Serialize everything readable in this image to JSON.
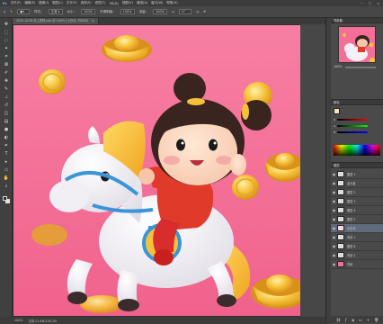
{
  "menu": [
    "文件(F)",
    "编辑(E)",
    "图像(I)",
    "图层(L)",
    "文字(Y)",
    "选择(S)",
    "滤镜(T)",
    "3D(D)",
    "视图(V)",
    "增强(A)",
    "窗口(W)",
    "帮助(H)"
  ],
  "window_controls": [
    "−",
    "□",
    "×"
  ],
  "options": {
    "tool_label": "样式：",
    "size_label": "大小：",
    "size_value": "100%",
    "mode_label": "不透明度：",
    "opacity_value": "100%",
    "flow_label": "流量：",
    "flow_value": "100%",
    "angle_label": "∠",
    "angle_value": "0°"
  },
  "tabs": [
    {
      "label": "2025-0226-马上发财.psd @ 100% (小白马, RGB/8)",
      "close": "×"
    }
  ],
  "status": {
    "zoom": "100%",
    "doc": "文档:21.6M/138.2M"
  },
  "panels": {
    "navigator_title": "导航器",
    "navigator_zoom": "100%",
    "color_title": "颜色",
    "layers_title": "图层"
  },
  "layers": [
    {
      "name": "图层 1",
      "selected": false
    },
    {
      "name": "金元宝",
      "selected": false
    },
    {
      "name": "图层 2",
      "selected": false
    },
    {
      "name": "图层 3",
      "selected": false
    },
    {
      "name": "图层 4",
      "selected": false
    },
    {
      "name": "图层 5",
      "selected": false
    },
    {
      "name": "小白马",
      "selected": true
    },
    {
      "name": "背景 1",
      "selected": false
    },
    {
      "name": "图层 6",
      "selected": false
    },
    {
      "name": "背景 2",
      "selected": false
    },
    {
      "name": "背景",
      "selected": false
    }
  ],
  "colors": {
    "accent": "#ff6f9a",
    "selected_layer": "#5f6b7a",
    "gold": "#f6c13a",
    "horse_white": "#f4f2f6"
  }
}
